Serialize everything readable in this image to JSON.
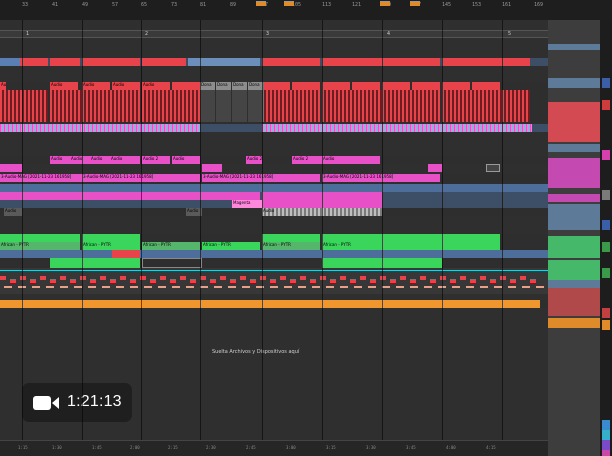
{
  "ruler": {
    "top_numbers": [
      "33",
      "41",
      "49",
      "57",
      "65",
      "73",
      "81",
      "89",
      "97",
      "105",
      "113",
      "121",
      "129",
      "137",
      "145",
      "153",
      "161",
      "169"
    ],
    "locators": [
      "1",
      "2",
      "3",
      "4",
      "5"
    ]
  },
  "clip_labels": {
    "red_row": [
      "Audio",
      "Audio",
      "Audio",
      "Audio",
      "Audio"
    ],
    "gray_blocks": [
      "Dona",
      "Dona",
      "Dona",
      "Dona"
    ],
    "pink_audio": [
      "Audio",
      "Audio",
      "Audio",
      "Audio",
      "Audio 2",
      "Audio",
      "Audio 2",
      "Audio 2",
      "Audio"
    ],
    "pink_midi": [
      "3-Audio-MAG [2021-11-23 161958]",
      "3-Audio-MAG [2021-11-23 161958]",
      "3-Audio-MAG [2021-11-23 161958]",
      "3-Audio-MAG [2021-11-23 161958]"
    ],
    "magenta_small": [
      "Magenta"
    ],
    "gray_audio": [
      "Audio",
      "Audio",
      "Audio"
    ],
    "green_labels": [
      "African - PYTR",
      "African - PYTR",
      "African - PYTR",
      "African - PYTR",
      "African - PYTR",
      "African - PYTR"
    ],
    "drop_zone": "Suelta Archivos y Dispositivos aquí"
  },
  "video_badge": {
    "icon": "video-camera-icon",
    "duration": "1:21:13"
  },
  "bottom_numbers": [
    "1:15",
    "1:30",
    "1:45",
    "2:00",
    "2:15",
    "2:30",
    "2:45",
    "3:00",
    "3:15",
    "3:30",
    "3:45",
    "4:00",
    "4:15"
  ],
  "colors": {
    "red": "#e8424a",
    "blue": "#5a7fb3",
    "pink": "#e850c8",
    "green": "#3ad65c",
    "orange": "#f0962e",
    "gray_clip": "#8d8d8d"
  }
}
